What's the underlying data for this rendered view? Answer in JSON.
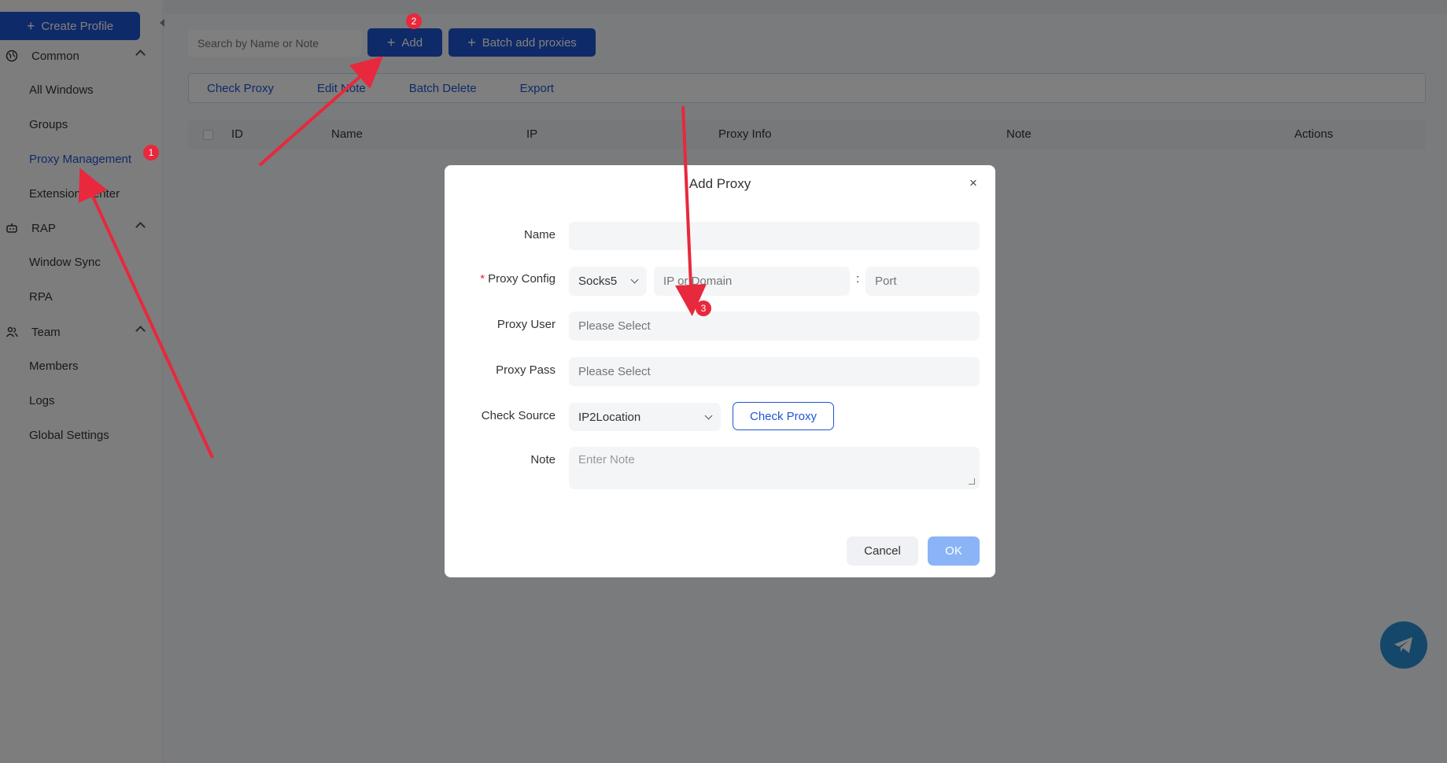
{
  "sidebar": {
    "create_label": "Create Profile",
    "groups": [
      {
        "label": "Common",
        "icon": "globe-icon"
      },
      {
        "label": "RAP",
        "icon": "robot-icon"
      },
      {
        "label": "Team",
        "icon": "team-icon"
      }
    ],
    "items": {
      "all_windows": "All Windows",
      "groups": "Groups",
      "proxy_management": "Proxy Management",
      "extension_center": "Extension Center",
      "window_sync": "Window Sync",
      "rpa": "RPA",
      "members": "Members",
      "logs": "Logs",
      "global_settings": "Global Settings"
    }
  },
  "main": {
    "search_placeholder": "Search by Name or Note",
    "add_label": "Add",
    "batch_add_label": "Batch add proxies",
    "toolbar": [
      "Check Proxy",
      "Edit Note",
      "Batch Delete",
      "Export"
    ],
    "columns": [
      "ID",
      "Name",
      "IP",
      "Proxy Info",
      "Note",
      "Actions"
    ]
  },
  "modal": {
    "title": "Add Proxy",
    "close": "×",
    "name_label": "Name",
    "proxy_config_label": "Proxy Config",
    "proxy_type": "Socks5",
    "ip_placeholder": "IP or Domain",
    "colon": ":",
    "port_placeholder": "Port",
    "proxy_user_label": "Proxy User",
    "proxy_user_placeholder": "Please Select",
    "proxy_pass_label": "Proxy Pass",
    "proxy_pass_placeholder": "Please Select",
    "check_source_label": "Check Source",
    "check_source_value": "IP2Location",
    "check_proxy_label": "Check Proxy",
    "note_label": "Note",
    "note_placeholder": "Enter Note",
    "cancel_label": "Cancel",
    "ok_label": "OK"
  },
  "annotations": {
    "badge_1": "1",
    "badge_2": "2",
    "badge_3": "3",
    "arrow_color": "#e8283c"
  },
  "colors": {
    "primary": "#1f55d1",
    "ok_disabled": "#8ab4f6",
    "telegram": "#2a8fd6"
  }
}
